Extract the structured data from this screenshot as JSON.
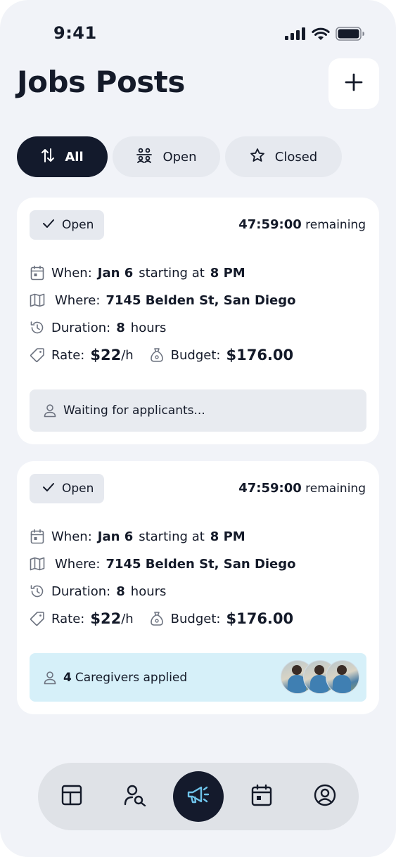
{
  "status_bar": {
    "time": "9:41",
    "icons": [
      "signal-icon",
      "wifi-icon",
      "battery-icon"
    ]
  },
  "header": {
    "title": "Jobs Posts",
    "add_icon": "plus-icon"
  },
  "filters": [
    {
      "label": "All",
      "icon": "arrows-up-down-icon",
      "active": true
    },
    {
      "label": "Open",
      "icon": "people-icon",
      "active": false
    },
    {
      "label": "Closed",
      "icon": "star-icon",
      "active": false
    }
  ],
  "labels": {
    "when": "When:",
    "starting_at": "starting at",
    "where": "Where:",
    "duration": "Duration:",
    "hours": "hours",
    "rate": "Rate:",
    "per_hour": "/h",
    "budget": "Budget:",
    "remaining": "remaining"
  },
  "jobs": [
    {
      "status": "Open",
      "countdown": "47:59:00",
      "date": "Jan 6",
      "time": "8 PM",
      "address": "7145 Belden St, San Diego",
      "duration": "8",
      "rate": "$22",
      "budget": "$176.00",
      "applicants_text": "Waiting for applicants..."
    },
    {
      "status": "Open",
      "countdown": "47:59:00",
      "date": "Jan 6",
      "time": "8 PM",
      "address": "7145 Belden St, San Diego",
      "duration": "8",
      "rate": "$22",
      "budget": "$176.00",
      "applicants_count": "4",
      "applicants_text": "Caregivers applied"
    }
  ],
  "nav": [
    {
      "icon": "dashboard-icon",
      "active": false
    },
    {
      "icon": "search-user-icon",
      "active": false
    },
    {
      "icon": "megaphone-icon",
      "active": true
    },
    {
      "icon": "calendar-icon",
      "active": false
    },
    {
      "icon": "profile-icon",
      "active": false
    }
  ],
  "colors": {
    "background": "#f1f3f8",
    "dark": "#131a2c",
    "chip": "#e6e9ef",
    "applied_bar": "#d6f0f9",
    "nav_accent": "#6ec3ea"
  }
}
